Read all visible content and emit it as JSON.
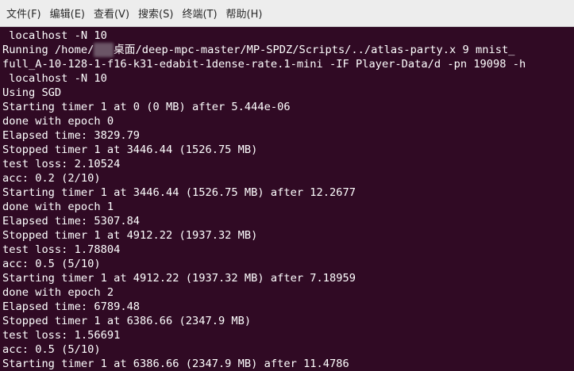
{
  "menu": {
    "items": [
      {
        "label": "文件(F)",
        "name": "menu-file"
      },
      {
        "label": "编辑(E)",
        "name": "menu-edit"
      },
      {
        "label": "查看(V)",
        "name": "menu-view"
      },
      {
        "label": "搜索(S)",
        "name": "menu-search"
      },
      {
        "label": "终端(T)",
        "name": "menu-terminal"
      },
      {
        "label": "帮助(H)",
        "name": "menu-help"
      }
    ]
  },
  "terminal": {
    "background": "#300a24",
    "foreground": "#ffffff",
    "lines": [
      " localhost -N 10",
      "Running /home/",
      "full_A-10-128-1-f16-k31-edabit-1dense-rate.1-mini -IF Player-Data/d -pn 19098 -h",
      " localhost -N 10",
      "Using SGD",
      "Starting timer 1 at 0 (0 MB) after 5.444e-06",
      "done with epoch 0",
      "Elapsed time: 3829.79",
      "Stopped timer 1 at 3446.44 (1526.75 MB)",
      "test loss: 2.10524",
      "acc: 0.2 (2/10)",
      "Starting timer 1 at 3446.44 (1526.75 MB) after 12.2677",
      "done with epoch 1",
      "Elapsed time: 5307.84",
      "Stopped timer 1 at 4912.22 (1937.32 MB)",
      "test loss: 1.78804",
      "acc: 0.5 (5/10)",
      "Starting timer 1 at 4912.22 (1937.32 MB) after 7.18959",
      "done with epoch 2",
      "Elapsed time: 6789.48",
      "Stopped timer 1 at 6386.66 (2347.9 MB)",
      "test loss: 1.56691",
      "acc: 0.5 (5/10)",
      "Starting timer 1 at 6386.66 (2347.9 MB) after 11.4786"
    ],
    "running_line_suffix": "桌面/deep-mpc-master/MP-SPDZ/Scripts/../atlas-party.x 9 mnist_"
  }
}
